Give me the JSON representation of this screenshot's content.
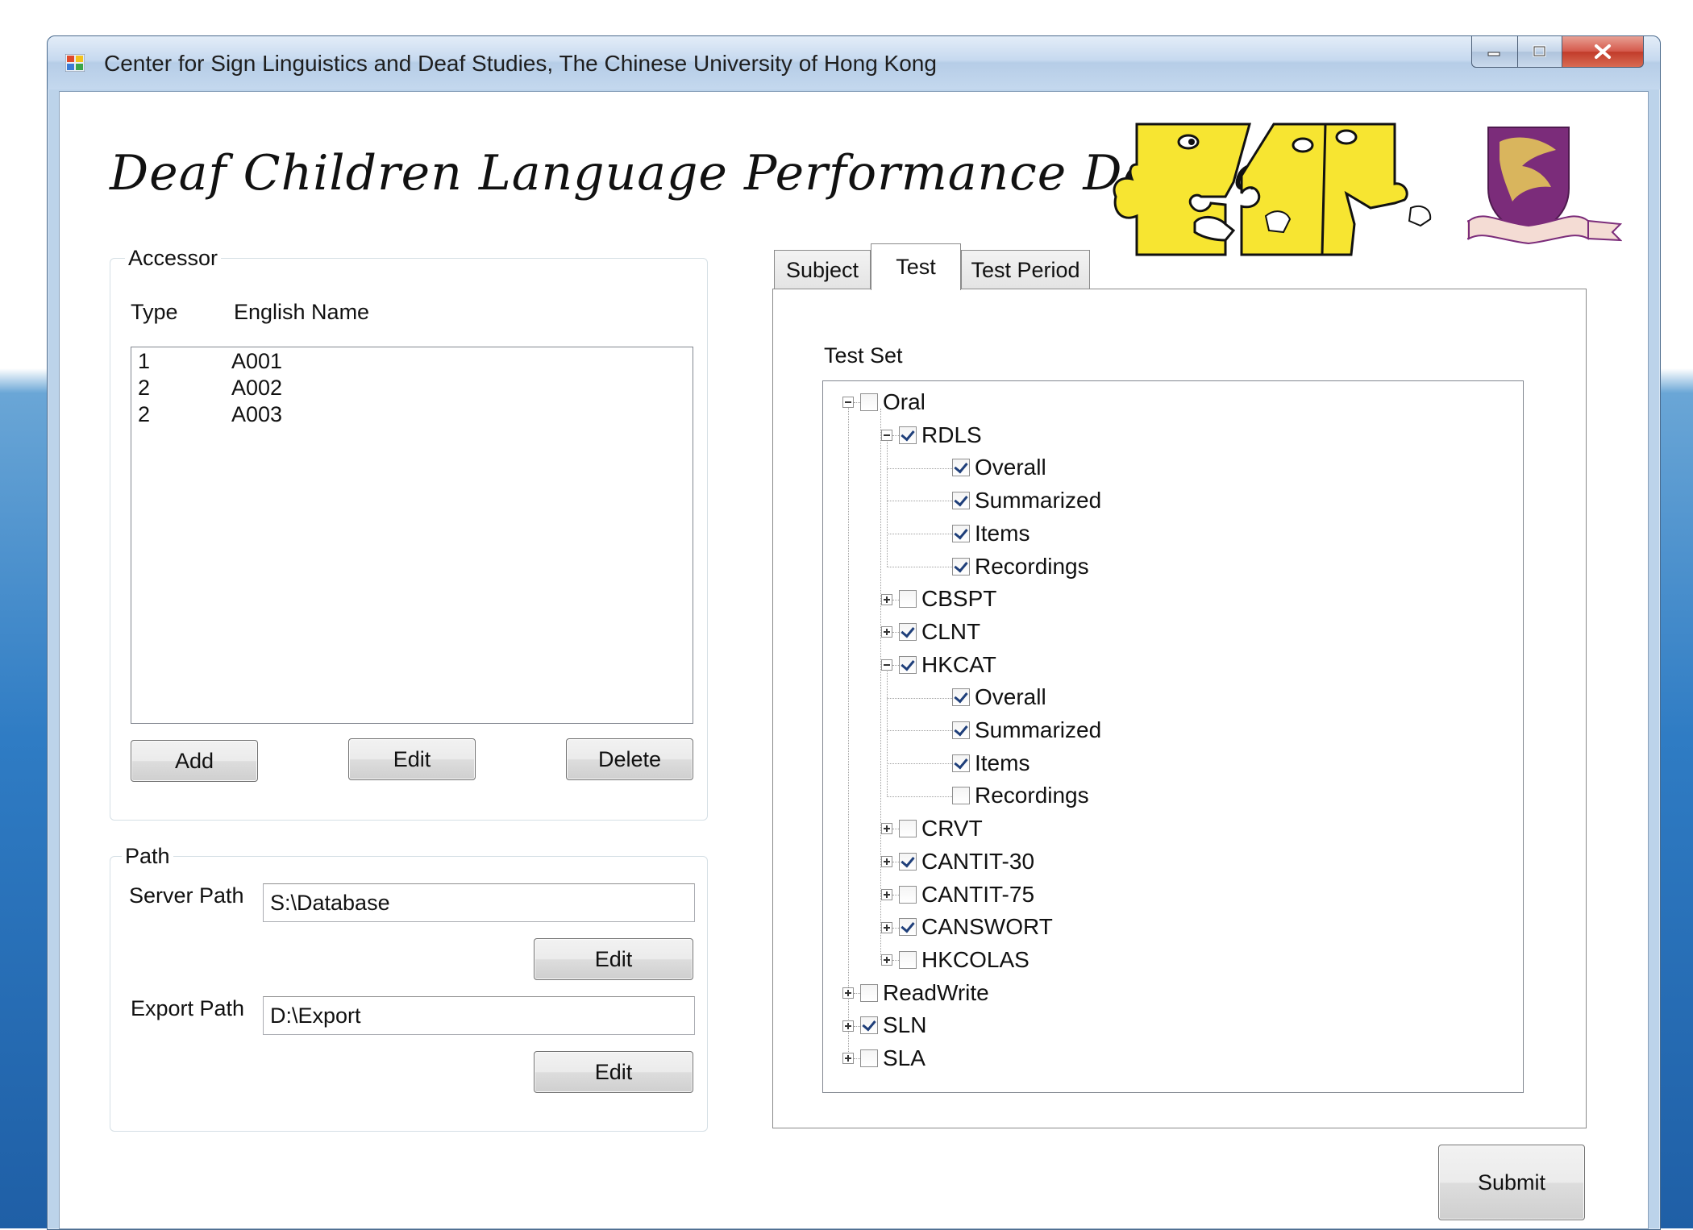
{
  "window": {
    "title": "Center for Sign Linguistics and Deaf Studies, The Chinese University of Hong Kong"
  },
  "app_title": "Deaf Children Language Performance Database",
  "accessor": {
    "group_label": "Accessor",
    "columns": [
      "Type",
      "English Name"
    ],
    "rows": [
      {
        "type": "1",
        "name": "A001"
      },
      {
        "type": "2",
        "name": "A002"
      },
      {
        "type": "2",
        "name": "A003"
      }
    ],
    "add_label": "Add",
    "edit_label": "Edit",
    "delete_label": "Delete"
  },
  "path": {
    "group_label": "Path",
    "server_label": "Server Path",
    "server_value": "S:\\Database",
    "server_edit_label": "Edit",
    "export_label": "Export Path",
    "export_value": "D:\\Export",
    "export_edit_label": "Edit"
  },
  "tabs": [
    "Subject",
    "Test",
    "Test Period"
  ],
  "active_tab": "Test",
  "test_set_label": "Test Set",
  "tree": [
    {
      "label": "Oral",
      "level": 0,
      "checked": false,
      "expander": "minus"
    },
    {
      "label": "RDLS",
      "level": 1,
      "checked": true,
      "expander": "minus"
    },
    {
      "label": "Overall",
      "level": 2,
      "checked": true,
      "expander": "none"
    },
    {
      "label": "Summarized",
      "level": 2,
      "checked": true,
      "expander": "none"
    },
    {
      "label": "Items",
      "level": 2,
      "checked": true,
      "expander": "none"
    },
    {
      "label": "Recordings",
      "level": 2,
      "checked": true,
      "expander": "none"
    },
    {
      "label": "CBSPT",
      "level": 1,
      "checked": false,
      "expander": "plus"
    },
    {
      "label": "CLNT",
      "level": 1,
      "checked": true,
      "expander": "plus"
    },
    {
      "label": "HKCAT",
      "level": 1,
      "checked": true,
      "expander": "minus"
    },
    {
      "label": "Overall",
      "level": 2,
      "checked": true,
      "expander": "none"
    },
    {
      "label": "Summarized",
      "level": 2,
      "checked": true,
      "expander": "none"
    },
    {
      "label": "Items",
      "level": 2,
      "checked": true,
      "expander": "none"
    },
    {
      "label": "Recordings",
      "level": 2,
      "checked": false,
      "expander": "none"
    },
    {
      "label": "CRVT",
      "level": 1,
      "checked": false,
      "expander": "plus"
    },
    {
      "label": "CANTIT-30",
      "level": 1,
      "checked": true,
      "expander": "plus"
    },
    {
      "label": "CANTIT-75",
      "level": 1,
      "checked": false,
      "expander": "plus"
    },
    {
      "label": "CANSWORT",
      "level": 1,
      "checked": true,
      "expander": "plus"
    },
    {
      "label": "HKCOLAS",
      "level": 1,
      "checked": false,
      "expander": "plus"
    },
    {
      "label": "ReadWrite",
      "level": 0,
      "checked": false,
      "expander": "plus"
    },
    {
      "label": "SLN",
      "level": 0,
      "checked": true,
      "expander": "plus"
    },
    {
      "label": "SLA",
      "level": 0,
      "checked": false,
      "expander": "plus"
    }
  ],
  "submit_label": "Submit",
  "colors": {
    "logo_yellow": "#f7e531",
    "crest_purple": "#7b2c7a",
    "window_frame": "#bcd3ea",
    "close_red": "#c13b2a"
  }
}
